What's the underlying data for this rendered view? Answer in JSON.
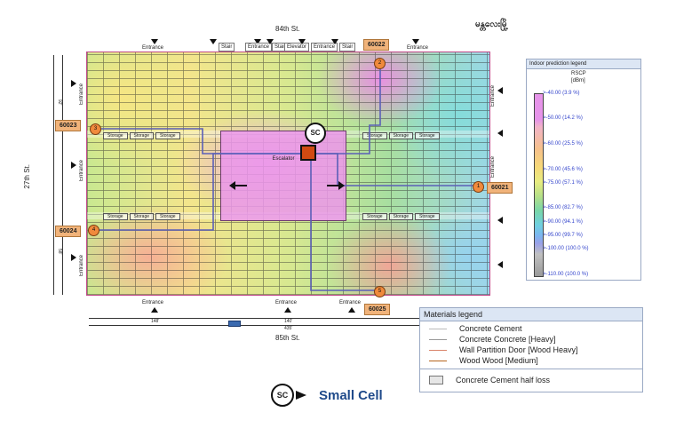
{
  "streets": {
    "top": "84th St.",
    "bottom": "85th St.",
    "left": "27th St."
  },
  "myanmar_label": "မန္တလေးမြို့",
  "entrances": {
    "label": "Entrance"
  },
  "gates": {
    "stair": "Stair",
    "entrance": "Entrance",
    "elevator": "Elevator"
  },
  "storage_label": "Storage",
  "escalator_label": "Escalator",
  "cell_ids": [
    "60022",
    "60023",
    "60021",
    "60024",
    "60025"
  ],
  "node_numbers": [
    "1",
    "2",
    "3",
    "4",
    "5"
  ],
  "sc_label": "SC",
  "dimensions": {
    "bottom_a": "148'",
    "bottom_b": "140'",
    "bottom_total": "435'",
    "left_a": "92'",
    "left_b": "58'"
  },
  "legend": {
    "title": "Indoor prediction legend",
    "metric": "RSCP",
    "unit": "[dBm]",
    "ticks": [
      ">-40.00 (3.9 %)",
      ">-50.00 (14.2 %)",
      ">-60.00 (25.5 %)",
      ">-70.00 (45.6 %)",
      ">-75.00 (57.1 %)",
      ">-85.00 (82.7 %)",
      ">-90.00 (94.1 %)",
      ">-95.00 (99.7 %)",
      ">-100.00 (100.0 %)",
      ">-110.00 (100.0 %)"
    ]
  },
  "materials": {
    "title": "Materials legend",
    "items": [
      {
        "label": "Concrete Cement",
        "color": "#c8c8c8"
      },
      {
        "label": "Concrete Concrete [Heavy]",
        "color": "#999999"
      },
      {
        "label": "Wall Partition Door [Wood Heavy]",
        "color": "#d9846a"
      },
      {
        "label": "Wood Wood [Medium]",
        "color": "#b5651d"
      }
    ],
    "half_loss": "Concrete Cement half loss"
  },
  "caption": {
    "text": "Small Cell",
    "icon": "SC"
  }
}
